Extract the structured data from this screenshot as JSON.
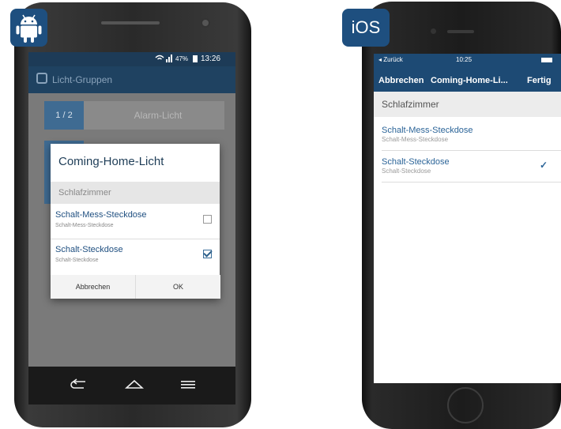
{
  "android": {
    "status": {
      "battery": "47%",
      "time": "13:26"
    },
    "appbar_title": "Licht-Gruppen",
    "background_rows": [
      {
        "badge": "1 / 2",
        "label": "Alarm-Licht"
      }
    ],
    "dialog": {
      "title": "Coming-Home-Licht",
      "section": "Schlafzimmer",
      "items": [
        {
          "name": "Schalt-Mess-Steckdose",
          "sub": "Schalt-Mess-Steckdose",
          "checked": false
        },
        {
          "name": "Schalt-Steckdose",
          "sub": "Schalt-Steckdose",
          "checked": true
        }
      ],
      "cancel_label": "Abbrechen",
      "ok_label": "OK"
    },
    "nav_icons": [
      "back-icon",
      "home-icon",
      "menu-icon"
    ]
  },
  "ios": {
    "logo_label": "iOS",
    "status": {
      "back": "◂ Zurück",
      "time": "10:25"
    },
    "navbar": {
      "cancel": "Abbrechen",
      "title": "Coming-Home-Li...",
      "done": "Fertig"
    },
    "section": "Schlafzimmer",
    "items": [
      {
        "name": "Schalt-Mess-Steckdose",
        "sub": "Schalt-Mess-Steckdose",
        "checked": false
      },
      {
        "name": "Schalt-Steckdose",
        "sub": "Schalt-Steckdose",
        "checked": true
      }
    ]
  },
  "colors": {
    "brand": "#1e4f7f",
    "accent": "#2b6498"
  }
}
